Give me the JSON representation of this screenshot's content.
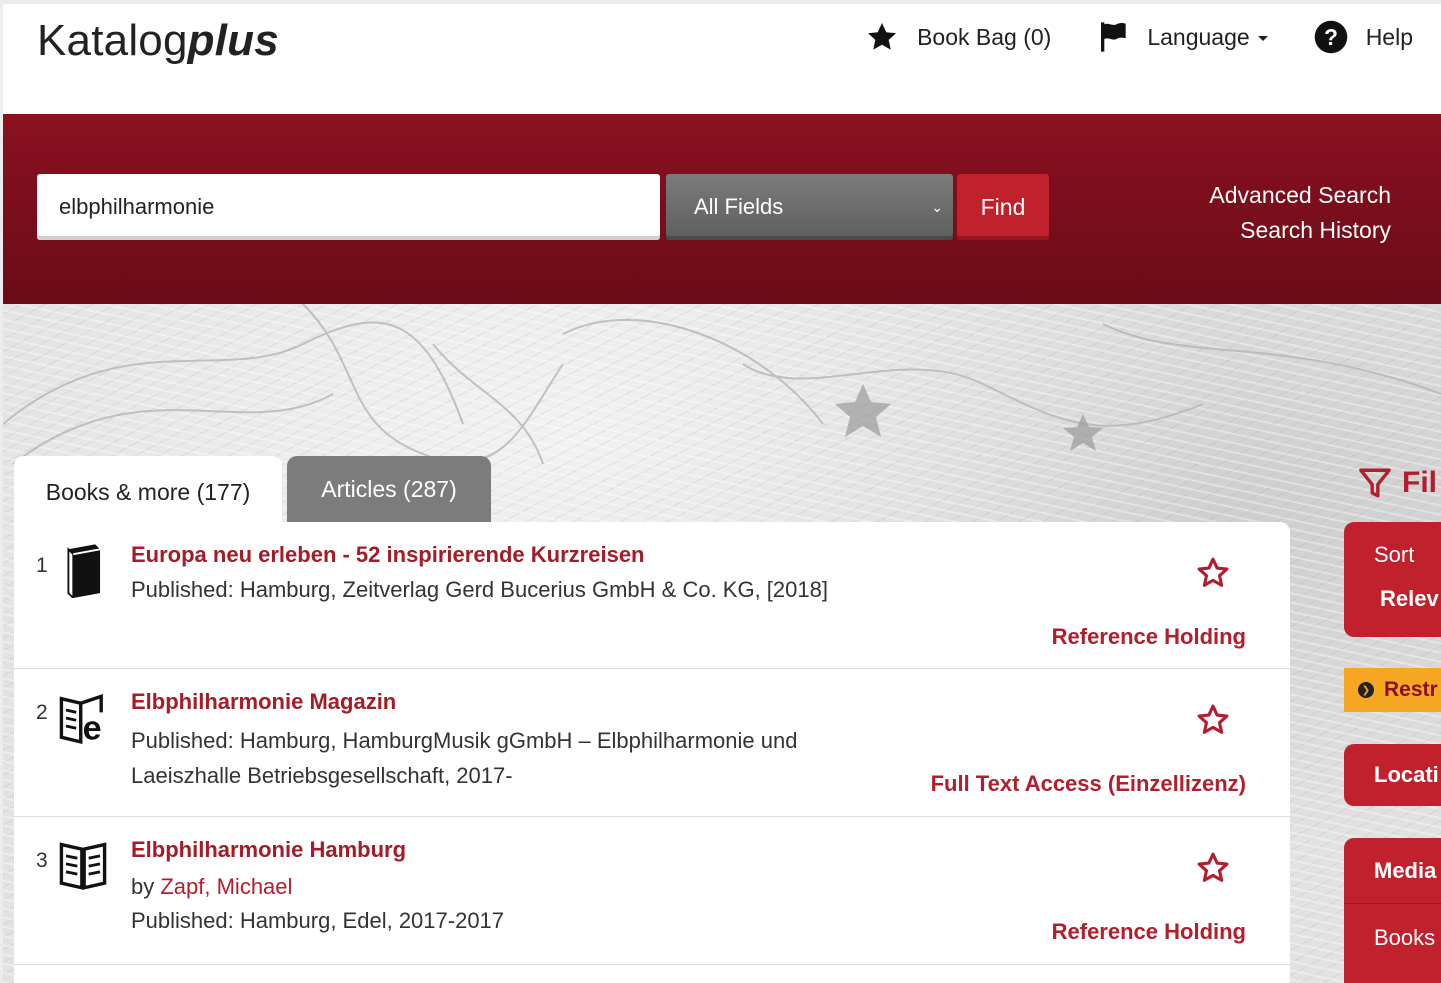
{
  "header": {
    "logo_regular": "Katalog",
    "logo_bold": "plus",
    "nav": {
      "book_bag": "Book Bag (0)",
      "language": "Language",
      "help": "Help"
    }
  },
  "search": {
    "query": "elbphilharmonie",
    "field": "All Fields",
    "find_label": "Find",
    "advanced_search": "Advanced Search",
    "search_history": "Search History"
  },
  "tabs": [
    {
      "label": "Books & more (177)",
      "active": true
    },
    {
      "label": "Articles (287)",
      "active": false
    }
  ],
  "results": [
    {
      "num": "1",
      "icon": "book-icon",
      "title": "Europa neu erleben - 52 inspirierende Kurzreisen",
      "published": "Published: Hamburg, Zeitverlag Gerd Bucerius GmbH & Co. KG, [2018]",
      "link": "Reference Holding"
    },
    {
      "num": "2",
      "icon": "ejournal-icon",
      "title": "Elbphilharmonie Magazin",
      "published_1": "Published: Hamburg, HamburgMusik gGmbH – Elbphilharmonie und",
      "published_2": "Laeiszhalle Betriebsgesellschaft, 2017-",
      "link": "Full Text Access (Einzellizenz)"
    },
    {
      "num": "3",
      "icon": "open-book-icon",
      "title": "Elbphilharmonie Hamburg",
      "by": "by ",
      "author": "Zapf, Michael",
      "published": "Published: Hamburg, Edel, 2017-2017",
      "link": "Reference Holding"
    }
  ],
  "sidebar": {
    "filter": "Fil",
    "sort_label": "Sort",
    "sort_value": "Relev",
    "restrict": "Restr",
    "location": "Locati",
    "media": "Media",
    "books": "Books"
  },
  "colors": {
    "brand_red": "#8b1020",
    "accent_red": "#c1212c",
    "link_red": "#b21e2b",
    "restrict_orange": "#f5a623"
  }
}
